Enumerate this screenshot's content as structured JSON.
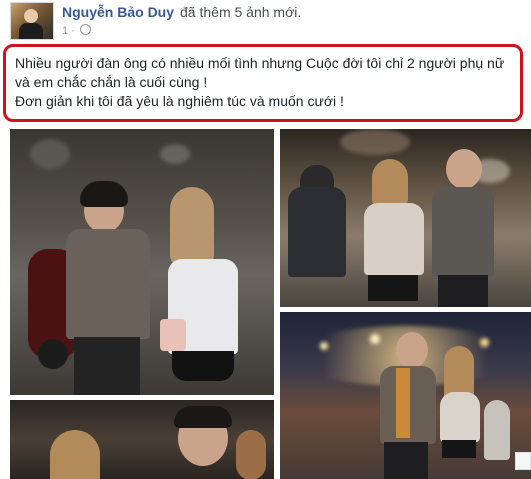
{
  "post": {
    "author": "Nguyễn Bảo Duy",
    "action": "đã thêm 5 ảnh mới.",
    "meta_time": "1 ·",
    "caption_line1": "Nhiều người đàn ông có nhiều mối tình nhưng Cuộc đời tôi chỉ 2 người phụ nữ và em chắc chắn là cuối cùng !",
    "caption_line2": "Đơn giản khi tôi đã yêu là nghiêm túc và muốn cưới !"
  },
  "icons": [
    "avatar",
    "globe-icon"
  ],
  "colors": {
    "author_link": "#365899",
    "highlight_border": "#d0121b",
    "text": "#1d2129",
    "meta": "#90949c"
  }
}
